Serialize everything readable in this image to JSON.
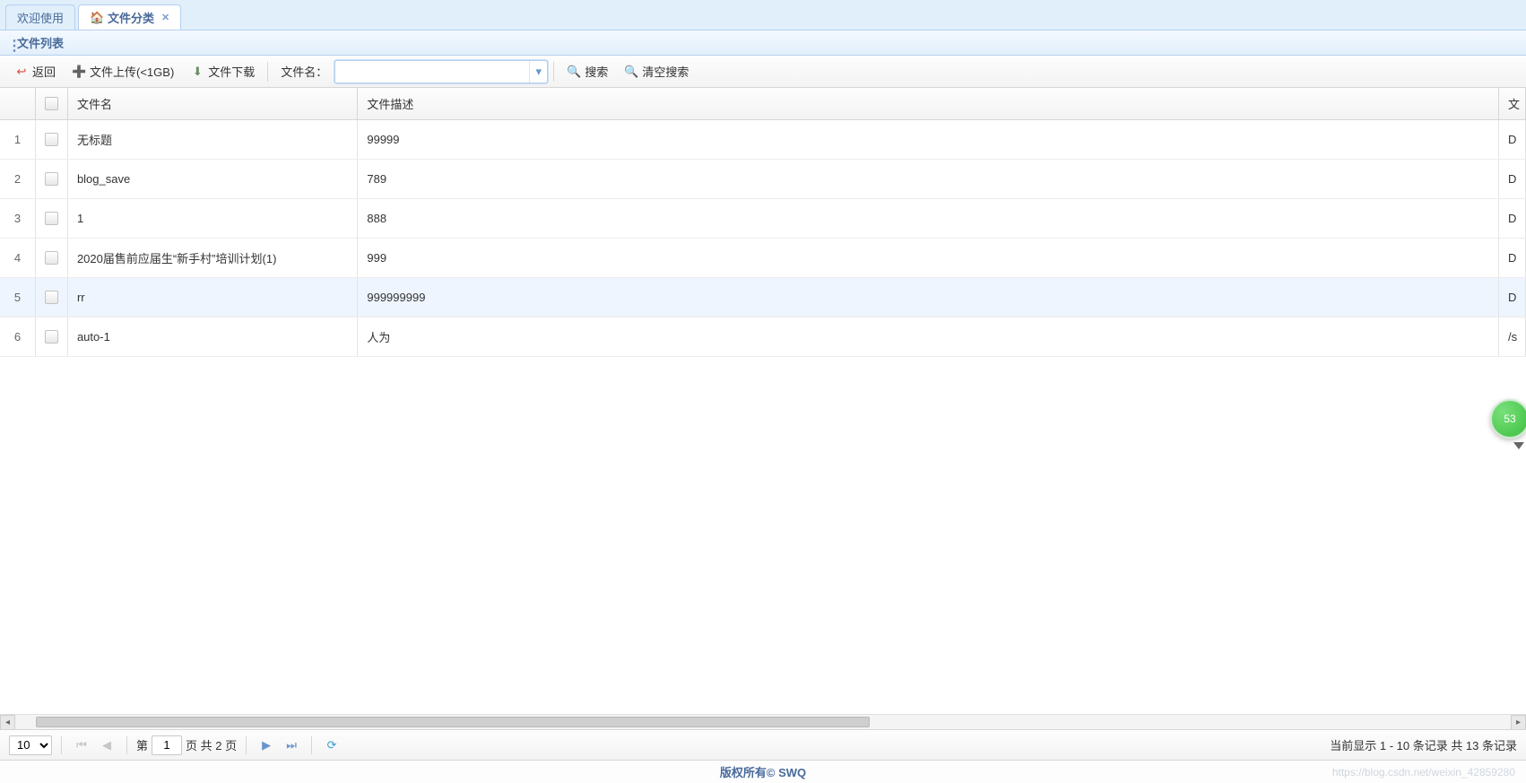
{
  "tabs": {
    "welcome": "欢迎使用",
    "active": "文件分类"
  },
  "panel": {
    "title": "文件列表"
  },
  "toolbar": {
    "back": "返回",
    "upload": "文件上传(<1GB)",
    "download": "文件下载",
    "filename_label": "文件名：",
    "filename_value": "",
    "search": "搜索",
    "clear_search": "清空搜索"
  },
  "columns": {
    "name": "文件名",
    "desc": "文件描述",
    "ext": "文"
  },
  "rows": [
    {
      "num": "1",
      "name": "无标题",
      "desc": "99999",
      "ext": "D",
      "selected": false
    },
    {
      "num": "2",
      "name": "blog_save",
      "desc": "789",
      "ext": "D",
      "selected": false
    },
    {
      "num": "3",
      "name": "1",
      "desc": "888",
      "ext": "D",
      "selected": false
    },
    {
      "num": "4",
      "name": "2020届售前应届生“新手村”培训计划(1)",
      "desc": "999",
      "ext": "D",
      "selected": false
    },
    {
      "num": "5",
      "name": "rr",
      "desc": "999999999",
      "ext": "D",
      "selected": true
    },
    {
      "num": "6",
      "name": "auto-1",
      "desc": "人为",
      "ext": "/s",
      "selected": false
    }
  ],
  "paging": {
    "page_size": "10",
    "label_prefix": "第",
    "current_page": "1",
    "label_middle": "页 共 2 页",
    "status": "当前显示 1 - 10 条记录 共 13 条记录"
  },
  "footer": {
    "copyright": "版权所有© SWQ",
    "watermark": "https://blog.csdn.net/weixin_42859280"
  },
  "badge": {
    "text": "53"
  }
}
